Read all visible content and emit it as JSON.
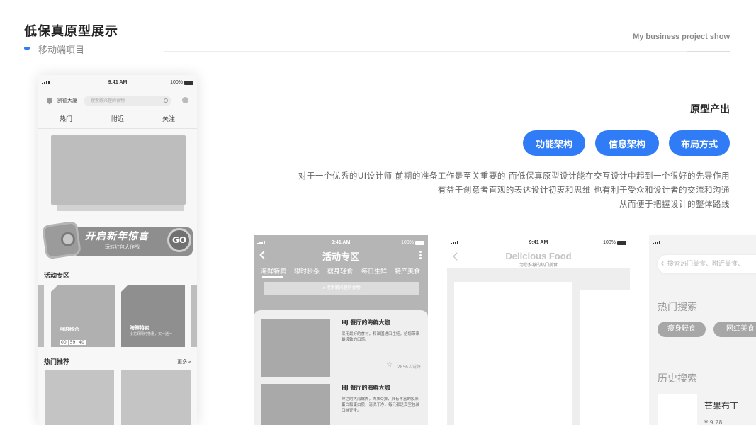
{
  "header": {
    "title": "低保真原型展示",
    "subtitle": "移动端项目",
    "english_tag": "My business project show"
  },
  "intro": {
    "section_title": "原型产出",
    "buttons": [
      "功能架构",
      "信息架构",
      "布局方式"
    ],
    "description": [
      "对于一个优秀的UI设计师 前期的准备工作是至关重要的 而低保真原型设计能在交互设计中起到一个很好的先导作用",
      "有益于创意者直观的表达设计初衷和思维 也有利于受众和设计者的交流和沟通",
      "从而便于把握设计的整体路线"
    ],
    "accent_color": "#2f7cf6"
  },
  "phone1": {
    "status_time": "9:41 AM",
    "status_battery": "100%",
    "location": "凯德大厦",
    "search_placeholder": "搜索感兴趣的食物",
    "tabs": [
      "热门",
      "附近",
      "关注"
    ],
    "promo_title": "开启新年惊喜",
    "promo_sub": "玩转红包大作战",
    "promo_go": "GO",
    "activity_section": "活动专区",
    "cards": [
      {
        "title": "限时秒杀",
        "countdown": [
          "00",
          "59",
          "40"
        ]
      },
      {
        "title": "海鲜特卖",
        "sub": "小龙虾限时特惠，买一送一"
      }
    ],
    "hot_section": "热门推荐",
    "more": "更多>"
  },
  "phone2": {
    "status_time": "9:41 AM",
    "status_battery": "100%",
    "title": "活动专区",
    "tabs": [
      "海鲜特卖",
      "限时秒杀",
      "瘦身轻食",
      "每日生鲜",
      "特产美食"
    ],
    "search_placeholder": "搜索感兴趣的食物",
    "items": [
      {
        "title": "HJ 餐厅的海鲜大咖",
        "desc": "采用最好的食材，和法国进口生鲑，给您带来最极致的口感。",
        "likes": "2856人说好"
      },
      {
        "title": "HJ 餐厅的海鲜大咖",
        "desc": "鲜活的大海螺肉，肉质Q弹，具有丰富的胶原蛋白和蛋白质，清洗干净，每只都是真空包装口味齐全。"
      }
    ]
  },
  "phone3": {
    "status_time": "9:41 AM",
    "status_battery": "100%",
    "title": "Delicious Food",
    "subtitle": "为您推荐的热门美食"
  },
  "phone4": {
    "search_placeholder": "搜索热门美食、附近美食、",
    "hot_search": "热门搜索",
    "chips": [
      "瘦身轻食",
      "网红美食"
    ],
    "history_search": "历史搜索",
    "history_item": "芒果布丁",
    "history_price": "¥ 9.28"
  }
}
